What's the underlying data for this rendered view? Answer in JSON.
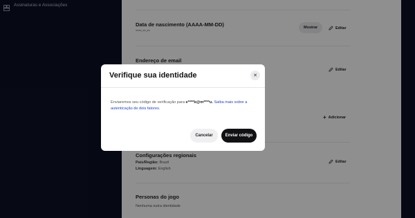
{
  "sidebar": {
    "items": [
      {
        "label": "Assinaturas e Associações",
        "icon": "subscriptions-icon"
      }
    ]
  },
  "account": {
    "birthdate": {
      "title": "Data de nascimento (AAAA-MM-DD)",
      "value": "****-**-**",
      "show_label": "Mostrar",
      "edit_label": "Editar"
    },
    "email": {
      "title": "Endereço de email",
      "edit_label": "Editar"
    },
    "phone": {
      "add_label": "Adicionar"
    },
    "regional": {
      "title": "Configurações regionais",
      "country_label": "País/Região:",
      "country_value": "Brazil",
      "language_label": "Linguagem:",
      "language_value": "English",
      "edit_label": "Editar"
    },
    "personas": {
      "title": "Personas do jogo",
      "empty": "Nenhuma outra identidade"
    }
  },
  "modal": {
    "title": "Verifique sua identidade",
    "close_icon": "close-icon",
    "body_prefix": "Enviaremos seu código de verificação para",
    "email_masked": "e****b@m****u.",
    "link_text": "Saiba mais sobre a autenticação de dois fatores.",
    "cancel_label": "Cancelar",
    "send_label": "Enviar código"
  },
  "colors": {
    "accent_link": "#1e3fd0",
    "primary_button": "#111114",
    "sidebar_bg": "#0c0f24"
  }
}
